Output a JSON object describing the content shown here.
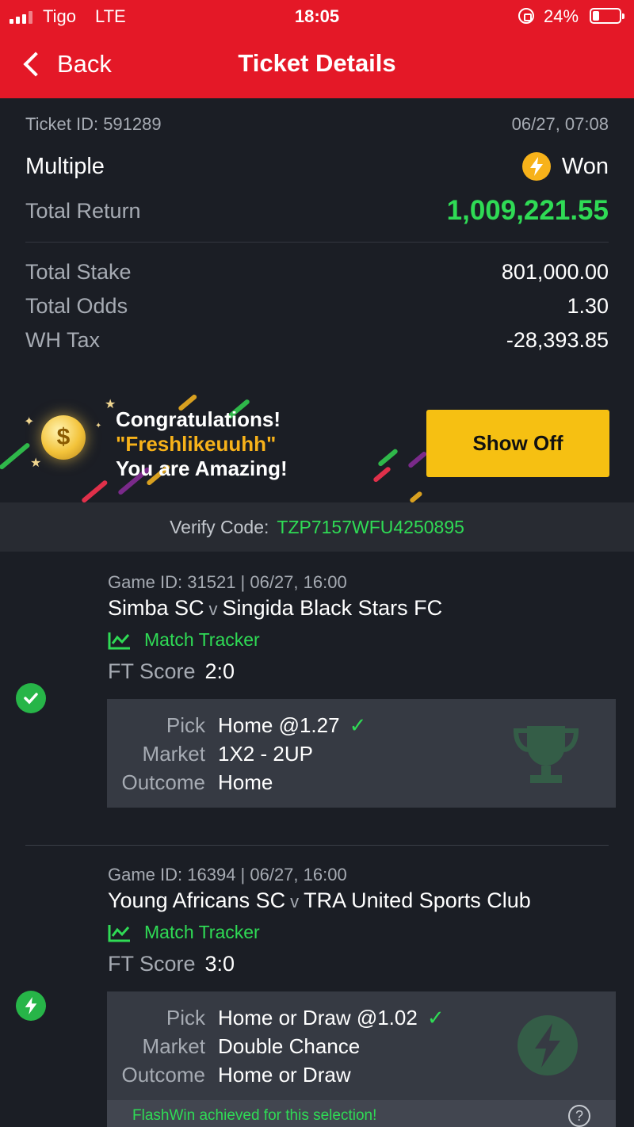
{
  "status_bar": {
    "carrier": "Tigo",
    "network": "LTE",
    "time": "18:05",
    "battery": "24%"
  },
  "header": {
    "back_label": "Back",
    "title": "Ticket Details"
  },
  "ticket": {
    "id_label": "Ticket ID: 591289",
    "datetime": "06/27, 07:08",
    "type": "Multiple",
    "result": "Won",
    "total_return_label": "Total Return",
    "total_return": "1,009,221.55",
    "total_stake_label": "Total Stake",
    "total_stake": "801,000.00",
    "total_odds_label": "Total Odds",
    "total_odds": "1.30",
    "wh_tax_label": "WH Tax",
    "wh_tax": "-28,393.85"
  },
  "banner": {
    "line1": "Congratulations!",
    "line2": "\"Freshlikeuuhh\"",
    "line3": "You are Amazing!",
    "button": "Show Off"
  },
  "verify": {
    "label": "Verify Code:",
    "code": "TZP7157WFU4250895"
  },
  "games": [
    {
      "id_line": "Game ID: 31521 | 06/27, 16:00",
      "home": "Simba SC",
      "vs": "v",
      "away": "Singida Black Stars FC",
      "tracker": "Match Tracker",
      "ft_label": "FT Score",
      "ft_score": "2:0",
      "pick_label": "Pick",
      "pick": "Home @1.27",
      "market_label": "Market",
      "market": "1X2 - 2UP",
      "outcome_label": "Outcome",
      "outcome": "Home",
      "status_icon": "check-icon"
    },
    {
      "id_line": "Game ID: 16394 | 06/27, 16:00",
      "home": "Young Africans SC",
      "vs": "v",
      "away": "TRA United Sports Club",
      "tracker": "Match Tracker",
      "ft_label": "FT Score",
      "ft_score": "3:0",
      "pick_label": "Pick",
      "pick": "Home or Draw @1.02",
      "market_label": "Market",
      "market": "Double Chance",
      "outcome_label": "Outcome",
      "outcome": "Home or Draw",
      "status_icon": "lightning-icon",
      "flashwin": "FlashWin achieved for this selection!"
    }
  ],
  "colors": {
    "brand_red": "#e41827",
    "win_green": "#2fdb55",
    "accent_yellow": "#f6c012",
    "background": "#1b1e25"
  }
}
